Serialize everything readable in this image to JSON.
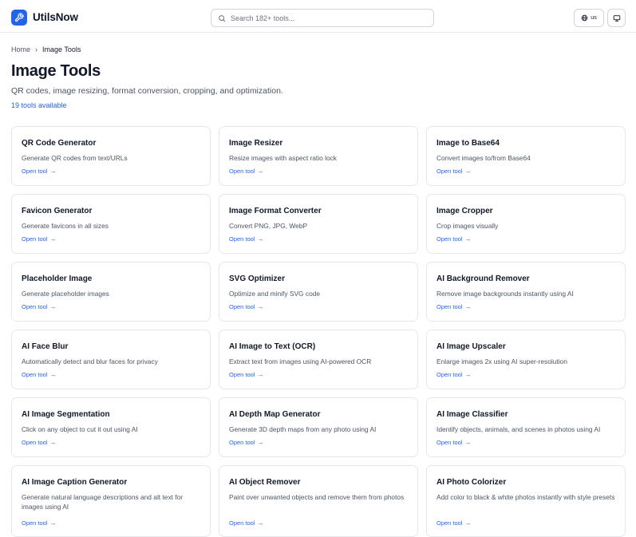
{
  "header": {
    "brand": "UtilsNow",
    "search_placeholder": "Search 182+ tools...",
    "lang_label": "us"
  },
  "breadcrumb": {
    "home": "Home",
    "separator": "›",
    "current": "Image Tools"
  },
  "page": {
    "title": "Image Tools",
    "description": "QR codes, image resizing, format conversion, cropping, and optimization.",
    "count": "19 tools available"
  },
  "cards": [
    {
      "title": "QR Code Generator",
      "desc": "Generate QR codes from text/URLs",
      "link": "Open tool"
    },
    {
      "title": "Image Resizer",
      "desc": "Resize images with aspect ratio lock",
      "link": "Open tool"
    },
    {
      "title": "Image to Base64",
      "desc": "Convert images to/from Base64",
      "link": "Open tool"
    },
    {
      "title": "Favicon Generator",
      "desc": "Generate favicons in all sizes",
      "link": "Open tool"
    },
    {
      "title": "Image Format Converter",
      "desc": "Convert PNG, JPG, WebP",
      "link": "Open tool"
    },
    {
      "title": "Image Cropper",
      "desc": "Crop images visually",
      "link": "Open tool"
    },
    {
      "title": "Placeholder Image",
      "desc": "Generate placeholder images",
      "link": "Open tool"
    },
    {
      "title": "SVG Optimizer",
      "desc": "Optimize and minify SVG code",
      "link": "Open tool"
    },
    {
      "title": "AI Background Remover",
      "desc": "Remove image backgrounds instantly using AI",
      "link": "Open tool"
    },
    {
      "title": "AI Face Blur",
      "desc": "Automatically detect and blur faces for privacy",
      "link": "Open tool"
    },
    {
      "title": "AI Image to Text (OCR)",
      "desc": "Extract text from images using AI-powered OCR",
      "link": "Open tool"
    },
    {
      "title": "AI Image Upscaler",
      "desc": "Enlarge images 2x using AI super-resolution",
      "link": "Open tool"
    },
    {
      "title": "AI Image Segmentation",
      "desc": "Click on any object to cut it out using AI",
      "link": "Open tool"
    },
    {
      "title": "AI Depth Map Generator",
      "desc": "Generate 3D depth maps from any photo using AI",
      "link": "Open tool"
    },
    {
      "title": "AI Image Classifier",
      "desc": "Identify objects, animals, and scenes in photos using AI",
      "link": "Open tool"
    },
    {
      "title": "AI Image Caption Generator",
      "desc": "Generate natural language descriptions and alt text for images using AI",
      "link": "Open tool"
    },
    {
      "title": "AI Object Remover",
      "desc": "Paint over unwanted objects and remove them from photos",
      "link": "Open tool"
    },
    {
      "title": "AI Photo Colorizer",
      "desc": "Add color to black & white photos instantly with style presets",
      "link": "Open tool"
    }
  ],
  "colors": {
    "accent": "#2563eb",
    "border": "#e5e7eb",
    "text": "#111827",
    "muted": "#4b5563"
  },
  "icons": {
    "logo": "wrench-icon",
    "search": "search-icon",
    "lang": "globe-icon",
    "display": "monitor-icon",
    "link_arrow": "arrow-right-icon"
  }
}
